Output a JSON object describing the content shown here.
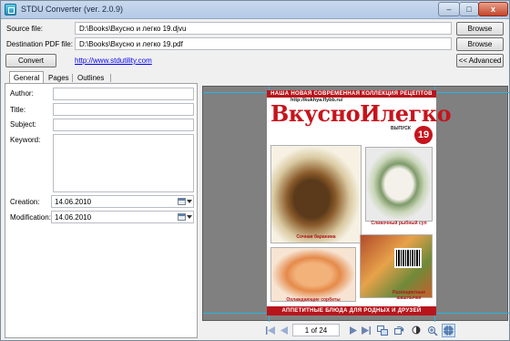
{
  "window": {
    "title": "STDU Converter (ver. 2.0.9)",
    "controls": {
      "minimize": "–",
      "maximize": "□",
      "close": "x"
    }
  },
  "source": {
    "label": "Source file:",
    "value": "D:\\Books\\Вкусно и легко 19.djvu",
    "browse": "Browse"
  },
  "destination": {
    "label": "Destination PDF file:",
    "value": "D:\\Books\\Вкусно и легко 19.pdf",
    "browse": "Browse"
  },
  "actions": {
    "convert": "Convert",
    "link": "http://www.stdutility.com",
    "advanced": "<< Advanced"
  },
  "tabs": [
    "General",
    "Pages",
    "Outlines"
  ],
  "general": {
    "author_label": "Author:",
    "title_label": "Title:",
    "subject_label": "Subject:",
    "keyword_label": "Keyword:",
    "creation_label": "Creation:",
    "creation_value": "14.06.2010",
    "modification_label": "Modification:",
    "modification_value": "14.06.2010"
  },
  "preview": {
    "top_banner": "НАША НОВАЯ СОВРЕМЕННАЯ КОЛЛЕКЦИЯ РЕЦЕПТОВ",
    "url": "http://kukhya.flybb.ru/",
    "magazine_title": "ВкусноИлегко",
    "issue_label": "ВЫПУСК",
    "issue_number": "19",
    "captions": [
      "Сочная баранина",
      "Сливочный рыбный суп",
      "Охлаждающие сорбеты",
      "Разноцветные шашлычки"
    ],
    "bottom_banner": "АППЕТИТНЫЕ БЛЮДА ДЛЯ РОДНЫХ И ДРУЗЕЙ",
    "colors": {
      "brand_red": "#c6141c",
      "guide_cyan": "#29b5e0"
    }
  },
  "navigation": {
    "page_indicator": "1 of 24",
    "icons": [
      "first-page-icon",
      "prev-page-icon",
      "next-page-icon",
      "last-page-icon",
      "fit-page-icon",
      "rotate-icon",
      "zoom-icon",
      "grid-icon"
    ]
  }
}
